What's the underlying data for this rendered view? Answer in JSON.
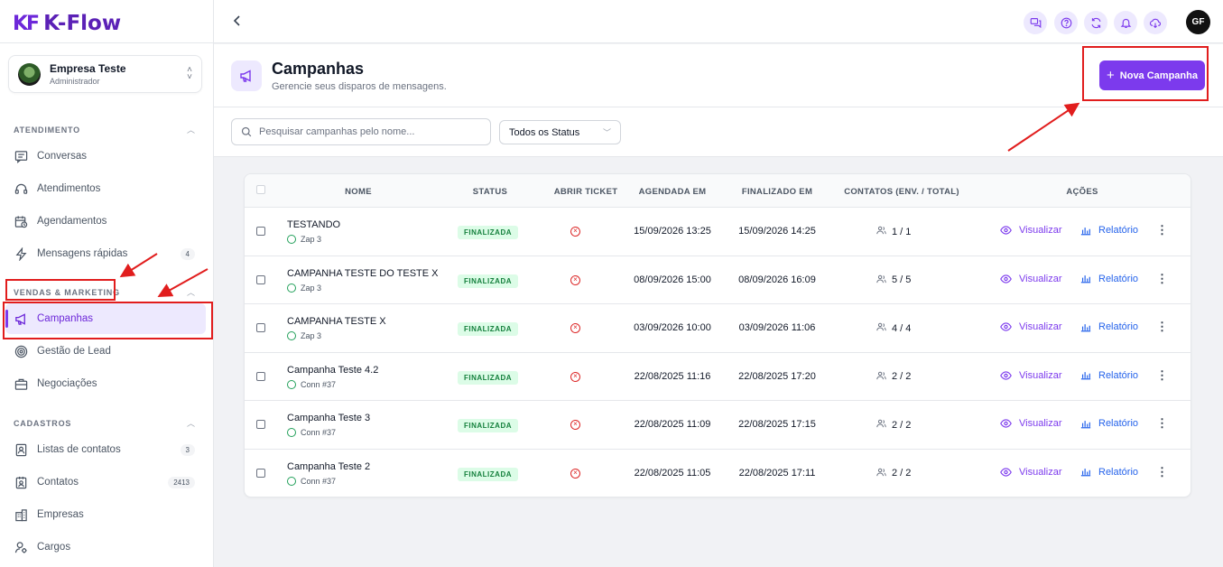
{
  "app": {
    "logo_mark": "KF",
    "logo_text": "K-Flow"
  },
  "company": {
    "name": "Empresa Teste",
    "role": "Administrador"
  },
  "sidebar": {
    "sections": [
      {
        "title": "ATENDIMENTO"
      },
      {
        "title": "VENDAS & MARKETING"
      },
      {
        "title": "CADASTROS"
      }
    ],
    "items": [
      {
        "label": "Conversas",
        "icon": "chat-lines-icon"
      },
      {
        "label": "Atendimentos",
        "icon": "headset-icon"
      },
      {
        "label": "Agendamentos",
        "icon": "calendar-clock-icon"
      },
      {
        "label": "Mensagens rápidas",
        "icon": "lightning-icon",
        "badge": "4"
      },
      {
        "label": "Campanhas",
        "icon": "megaphone-icon",
        "active": true
      },
      {
        "label": "Gestão de Lead",
        "icon": "target-icon"
      },
      {
        "label": "Negociações",
        "icon": "briefcase-icon"
      },
      {
        "label": "Listas de contatos",
        "icon": "contact-list-icon",
        "badge": "3"
      },
      {
        "label": "Contatos",
        "icon": "contact-card-icon",
        "badge": "2413"
      },
      {
        "label": "Empresas",
        "icon": "building-icon"
      },
      {
        "label": "Cargos",
        "icon": "user-gear-icon"
      }
    ]
  },
  "topbar": {
    "icons": [
      "chat-bubbles-icon",
      "help-icon",
      "refresh-icon",
      "bell-icon",
      "cloud-download-icon"
    ],
    "avatar_initials": "GF"
  },
  "page": {
    "title": "Campanhas",
    "subtitle": "Gerencie seus disparos de mensagens.",
    "new_button_label": "Nova Campanha"
  },
  "filters": {
    "search_placeholder": "Pesquisar campanhas pelo nome...",
    "status_value": "Todos os Status"
  },
  "table": {
    "headers": [
      "NOME",
      "STATUS",
      "ABRIR TICKET",
      "AGENDADA EM",
      "FINALIZADO EM",
      "CONTATOS (ENV. / TOTAL)",
      "AÇÕES"
    ],
    "view_label": "Visualizar",
    "report_label": "Relatório",
    "rows": [
      {
        "name": "TESTANDO",
        "connection": "Zap 3",
        "status": "FINALIZADA",
        "scheduled": "15/09/2026 13:25",
        "finished": "15/09/2026 14:25",
        "contacts": "1 / 1"
      },
      {
        "name": "CAMPANHA TESTE DO TESTE X",
        "connection": "Zap 3",
        "status": "FINALIZADA",
        "scheduled": "08/09/2026 15:00",
        "finished": "08/09/2026 16:09",
        "contacts": "5 / 5"
      },
      {
        "name": "CAMPANHA TESTE X",
        "connection": "Zap 3",
        "status": "FINALIZADA",
        "scheduled": "03/09/2026 10:00",
        "finished": "03/09/2026 11:06",
        "contacts": "4 / 4"
      },
      {
        "name": "Campanha Teste 4.2",
        "connection": "Conn #37",
        "status": "FINALIZADA",
        "scheduled": "22/08/2025 11:16",
        "finished": "22/08/2025 17:20",
        "contacts": "2 / 2"
      },
      {
        "name": "Campanha Teste 3",
        "connection": "Conn #37",
        "status": "FINALIZADA",
        "scheduled": "22/08/2025 11:09",
        "finished": "22/08/2025 17:15",
        "contacts": "2 / 2"
      },
      {
        "name": "Campanha Teste 2",
        "connection": "Conn #37",
        "status": "FINALIZADA",
        "scheduled": "22/08/2025 11:05",
        "finished": "22/08/2025 17:11",
        "contacts": "2 / 2"
      }
    ]
  },
  "colors": {
    "accent": "#7c3aed",
    "success": "#15803d",
    "danger": "#dc2626",
    "annotation": "#e11d1d"
  }
}
